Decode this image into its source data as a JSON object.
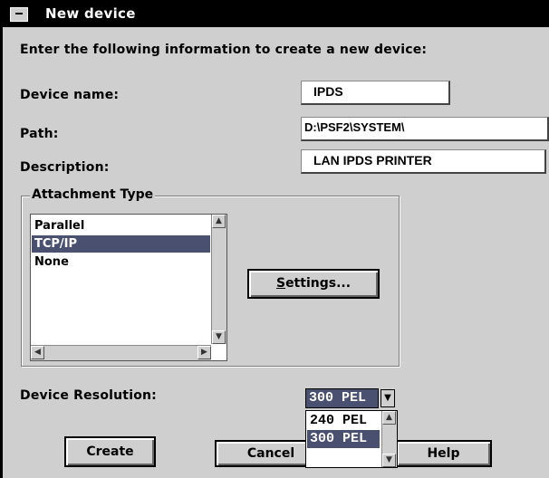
{
  "window": {
    "title": "New device"
  },
  "instructions": "Enter the following information to create a new device:",
  "device_name": {
    "label": "Device name:",
    "value": "IPDS"
  },
  "path": {
    "label": "Path:",
    "value": "D:\\PSF2\\SYSTEM\\"
  },
  "description": {
    "label": "Description:",
    "value": "LAN IPDS PRINTER"
  },
  "attachment_type": {
    "label": "Attachment Type",
    "items": [
      {
        "label": "Parallel",
        "selected": false
      },
      {
        "label": "TCP/IP",
        "selected": true
      },
      {
        "label": "None",
        "selected": false
      }
    ],
    "settings_button": "Settings..."
  },
  "resolution": {
    "label": "Device Resolution:",
    "value": "300 PEL",
    "options": [
      "240 PEL",
      "300 PEL"
    ],
    "selected_option": "300 PEL"
  },
  "buttons": {
    "create": "Create",
    "cancel": "Cancel",
    "help": "Help"
  },
  "colors": {
    "titlebar": "#000000",
    "selection": "#4a5070",
    "dialog_bg": "#cfcfcf"
  },
  "icons": [
    "system-menu-icon",
    "scroll-up-icon",
    "scroll-down-icon",
    "scroll-left-icon",
    "scroll-right-icon",
    "dropdown-arrow-icon"
  ]
}
